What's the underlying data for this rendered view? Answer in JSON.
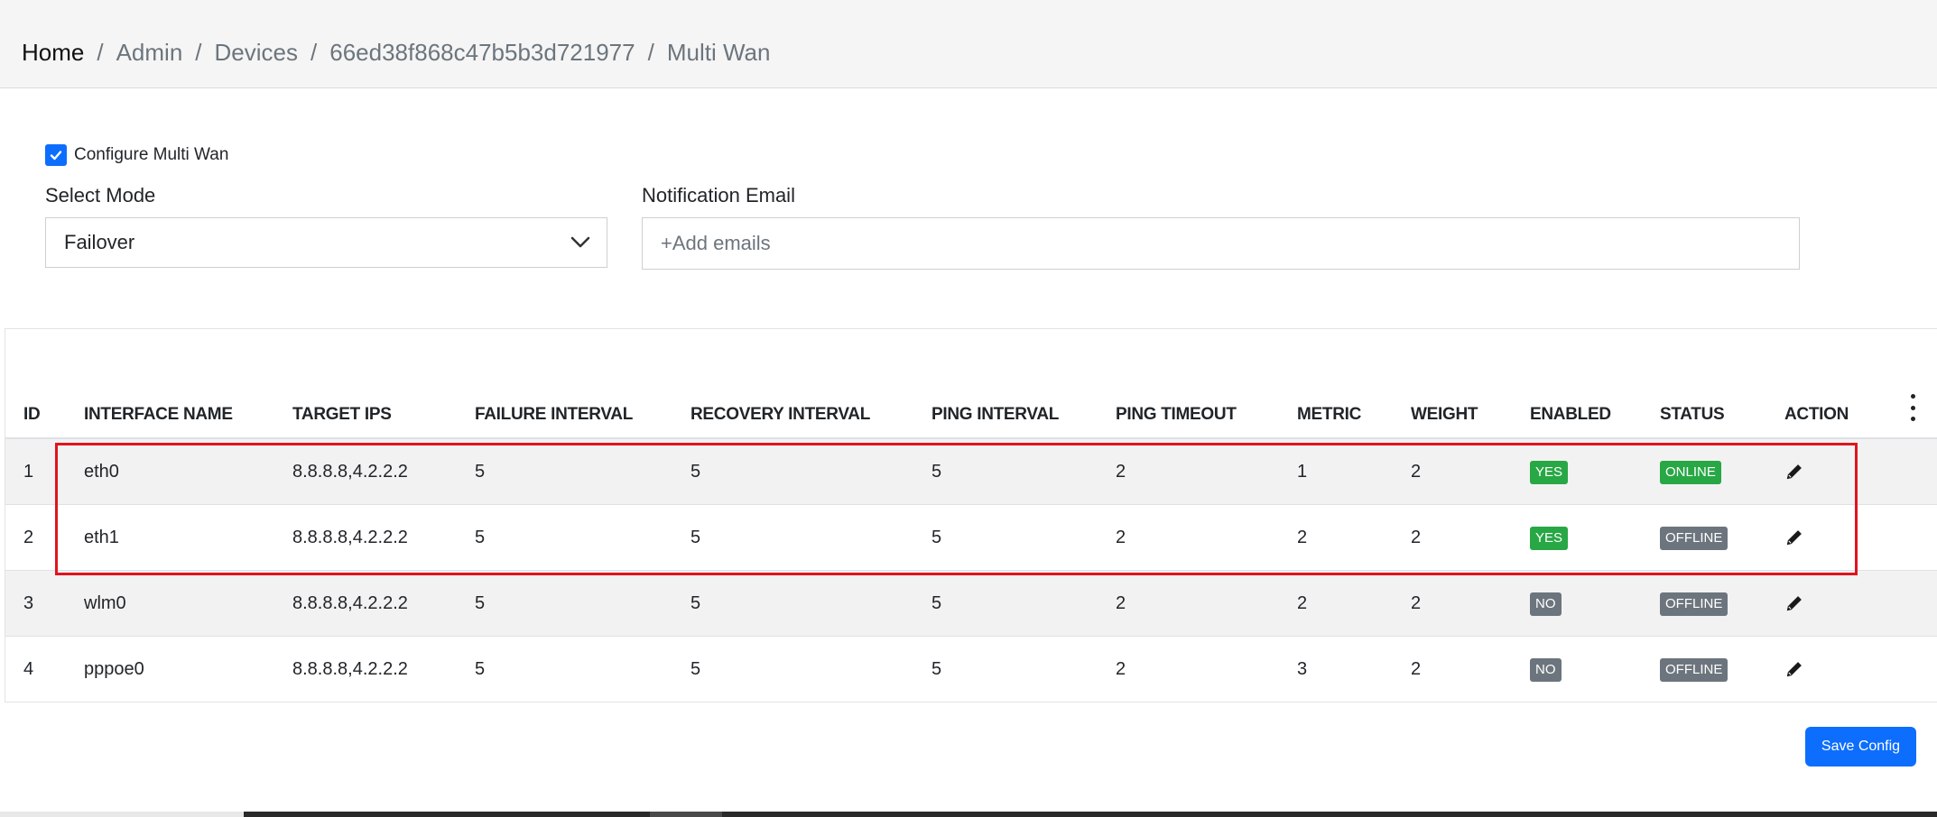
{
  "breadcrumb": {
    "items": [
      "Home",
      "Admin",
      "Devices",
      "66ed38f868c47b5b3d721977",
      "Multi Wan"
    ],
    "separator": "/"
  },
  "config": {
    "configure_label": "Configure Multi Wan",
    "configure_checked": true,
    "select_mode_label": "Select Mode",
    "select_mode_value": "Failover",
    "notification_email_label": "Notification Email",
    "notification_email_placeholder": "+Add emails"
  },
  "table": {
    "headers": [
      "ID",
      "INTERFACE NAME",
      "TARGET IPS",
      "FAILURE INTERVAL",
      "RECOVERY INTERVAL",
      "PING INTERVAL",
      "PING TIMEOUT",
      "METRIC",
      "WEIGHT",
      "ENABLED",
      "STATUS",
      "ACTION"
    ],
    "rows": [
      {
        "id": "1",
        "interface": "eth0",
        "target_ips": "8.8.8.8,4.2.2.2",
        "failure_interval": "5",
        "recovery_interval": "5",
        "ping_interval": "5",
        "ping_timeout": "2",
        "metric": "1",
        "weight": "2",
        "enabled": "YES",
        "status": "ONLINE"
      },
      {
        "id": "2",
        "interface": "eth1",
        "target_ips": "8.8.8.8,4.2.2.2",
        "failure_interval": "5",
        "recovery_interval": "5",
        "ping_interval": "5",
        "ping_timeout": "2",
        "metric": "2",
        "weight": "2",
        "enabled": "YES",
        "status": "OFFLINE"
      },
      {
        "id": "3",
        "interface": "wlm0",
        "target_ips": "8.8.8.8,4.2.2.2",
        "failure_interval": "5",
        "recovery_interval": "5",
        "ping_interval": "5",
        "ping_timeout": "2",
        "metric": "2",
        "weight": "2",
        "enabled": "NO",
        "status": "OFFLINE"
      },
      {
        "id": "4",
        "interface": "pppoe0",
        "target_ips": "8.8.8.8,4.2.2.2",
        "failure_interval": "5",
        "recovery_interval": "5",
        "ping_interval": "5",
        "ping_timeout": "2",
        "metric": "3",
        "weight": "2",
        "enabled": "NO",
        "status": "OFFLINE"
      }
    ]
  },
  "actions": {
    "save_label": "Save Config"
  },
  "colors": {
    "badge_yes": "#28a745",
    "badge_online": "#28a745",
    "badge_no": "#6c757d",
    "badge_offline": "#6c757d",
    "primary": "#0d6efd",
    "highlight_border": "#e0141e"
  },
  "icons": {
    "dropdown": "chevron-down-icon",
    "action": "pencil-icon",
    "menu": "kebab-menu-icon",
    "checkbox": "checkmark-icon"
  }
}
